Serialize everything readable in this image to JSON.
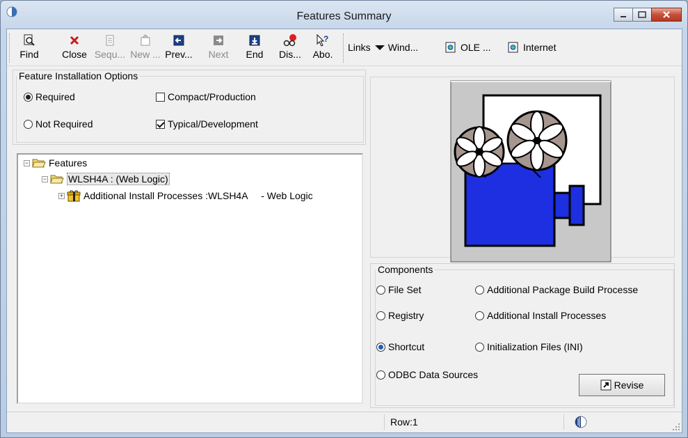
{
  "window": {
    "title": "Features Summary"
  },
  "toolbar": {
    "buttons": [
      {
        "id": "find",
        "label": "Find",
        "enabled": true
      },
      {
        "id": "close",
        "label": "Close",
        "enabled": true
      },
      {
        "id": "sequ",
        "label": "Sequ...",
        "enabled": false
      },
      {
        "id": "new",
        "label": "New ...",
        "enabled": false
      },
      {
        "id": "prev",
        "label": "Prev...",
        "enabled": true
      },
      {
        "id": "next",
        "label": "Next",
        "enabled": false
      },
      {
        "id": "end",
        "label": "End",
        "enabled": true
      },
      {
        "id": "dis",
        "label": "Dis...",
        "enabled": true
      },
      {
        "id": "abo",
        "label": "Abo.",
        "enabled": true
      }
    ],
    "links_label": "Links",
    "wind_label": "Wind...",
    "ole_label": "OLE ...",
    "internet_label": "Internet"
  },
  "install_options": {
    "legend": "Feature Installation Options",
    "required": "Required",
    "not_required": "Not Required",
    "compact": "Compact/Production",
    "typical": "Typical/Development",
    "selected": "Required",
    "compact_checked": false,
    "typical_checked": true
  },
  "tree": {
    "root": "Features",
    "child": "WLSH4A : (Web Logic)",
    "grandchild": "Additional Install Processes :WLSH4A     - Web Logic"
  },
  "components": {
    "legend": "Components",
    "file_set": "File Set",
    "additional_package": "Additional Package Build Processe",
    "registry": "Registry",
    "additional_install": "Additional Install Processes",
    "shortcut": "Shortcut",
    "ini_files": "Initialization Files (INI)",
    "odbc": "ODBC Data Sources",
    "selected": "Shortcut"
  },
  "revise_label": "Revise",
  "status": {
    "row": "Row:1"
  }
}
